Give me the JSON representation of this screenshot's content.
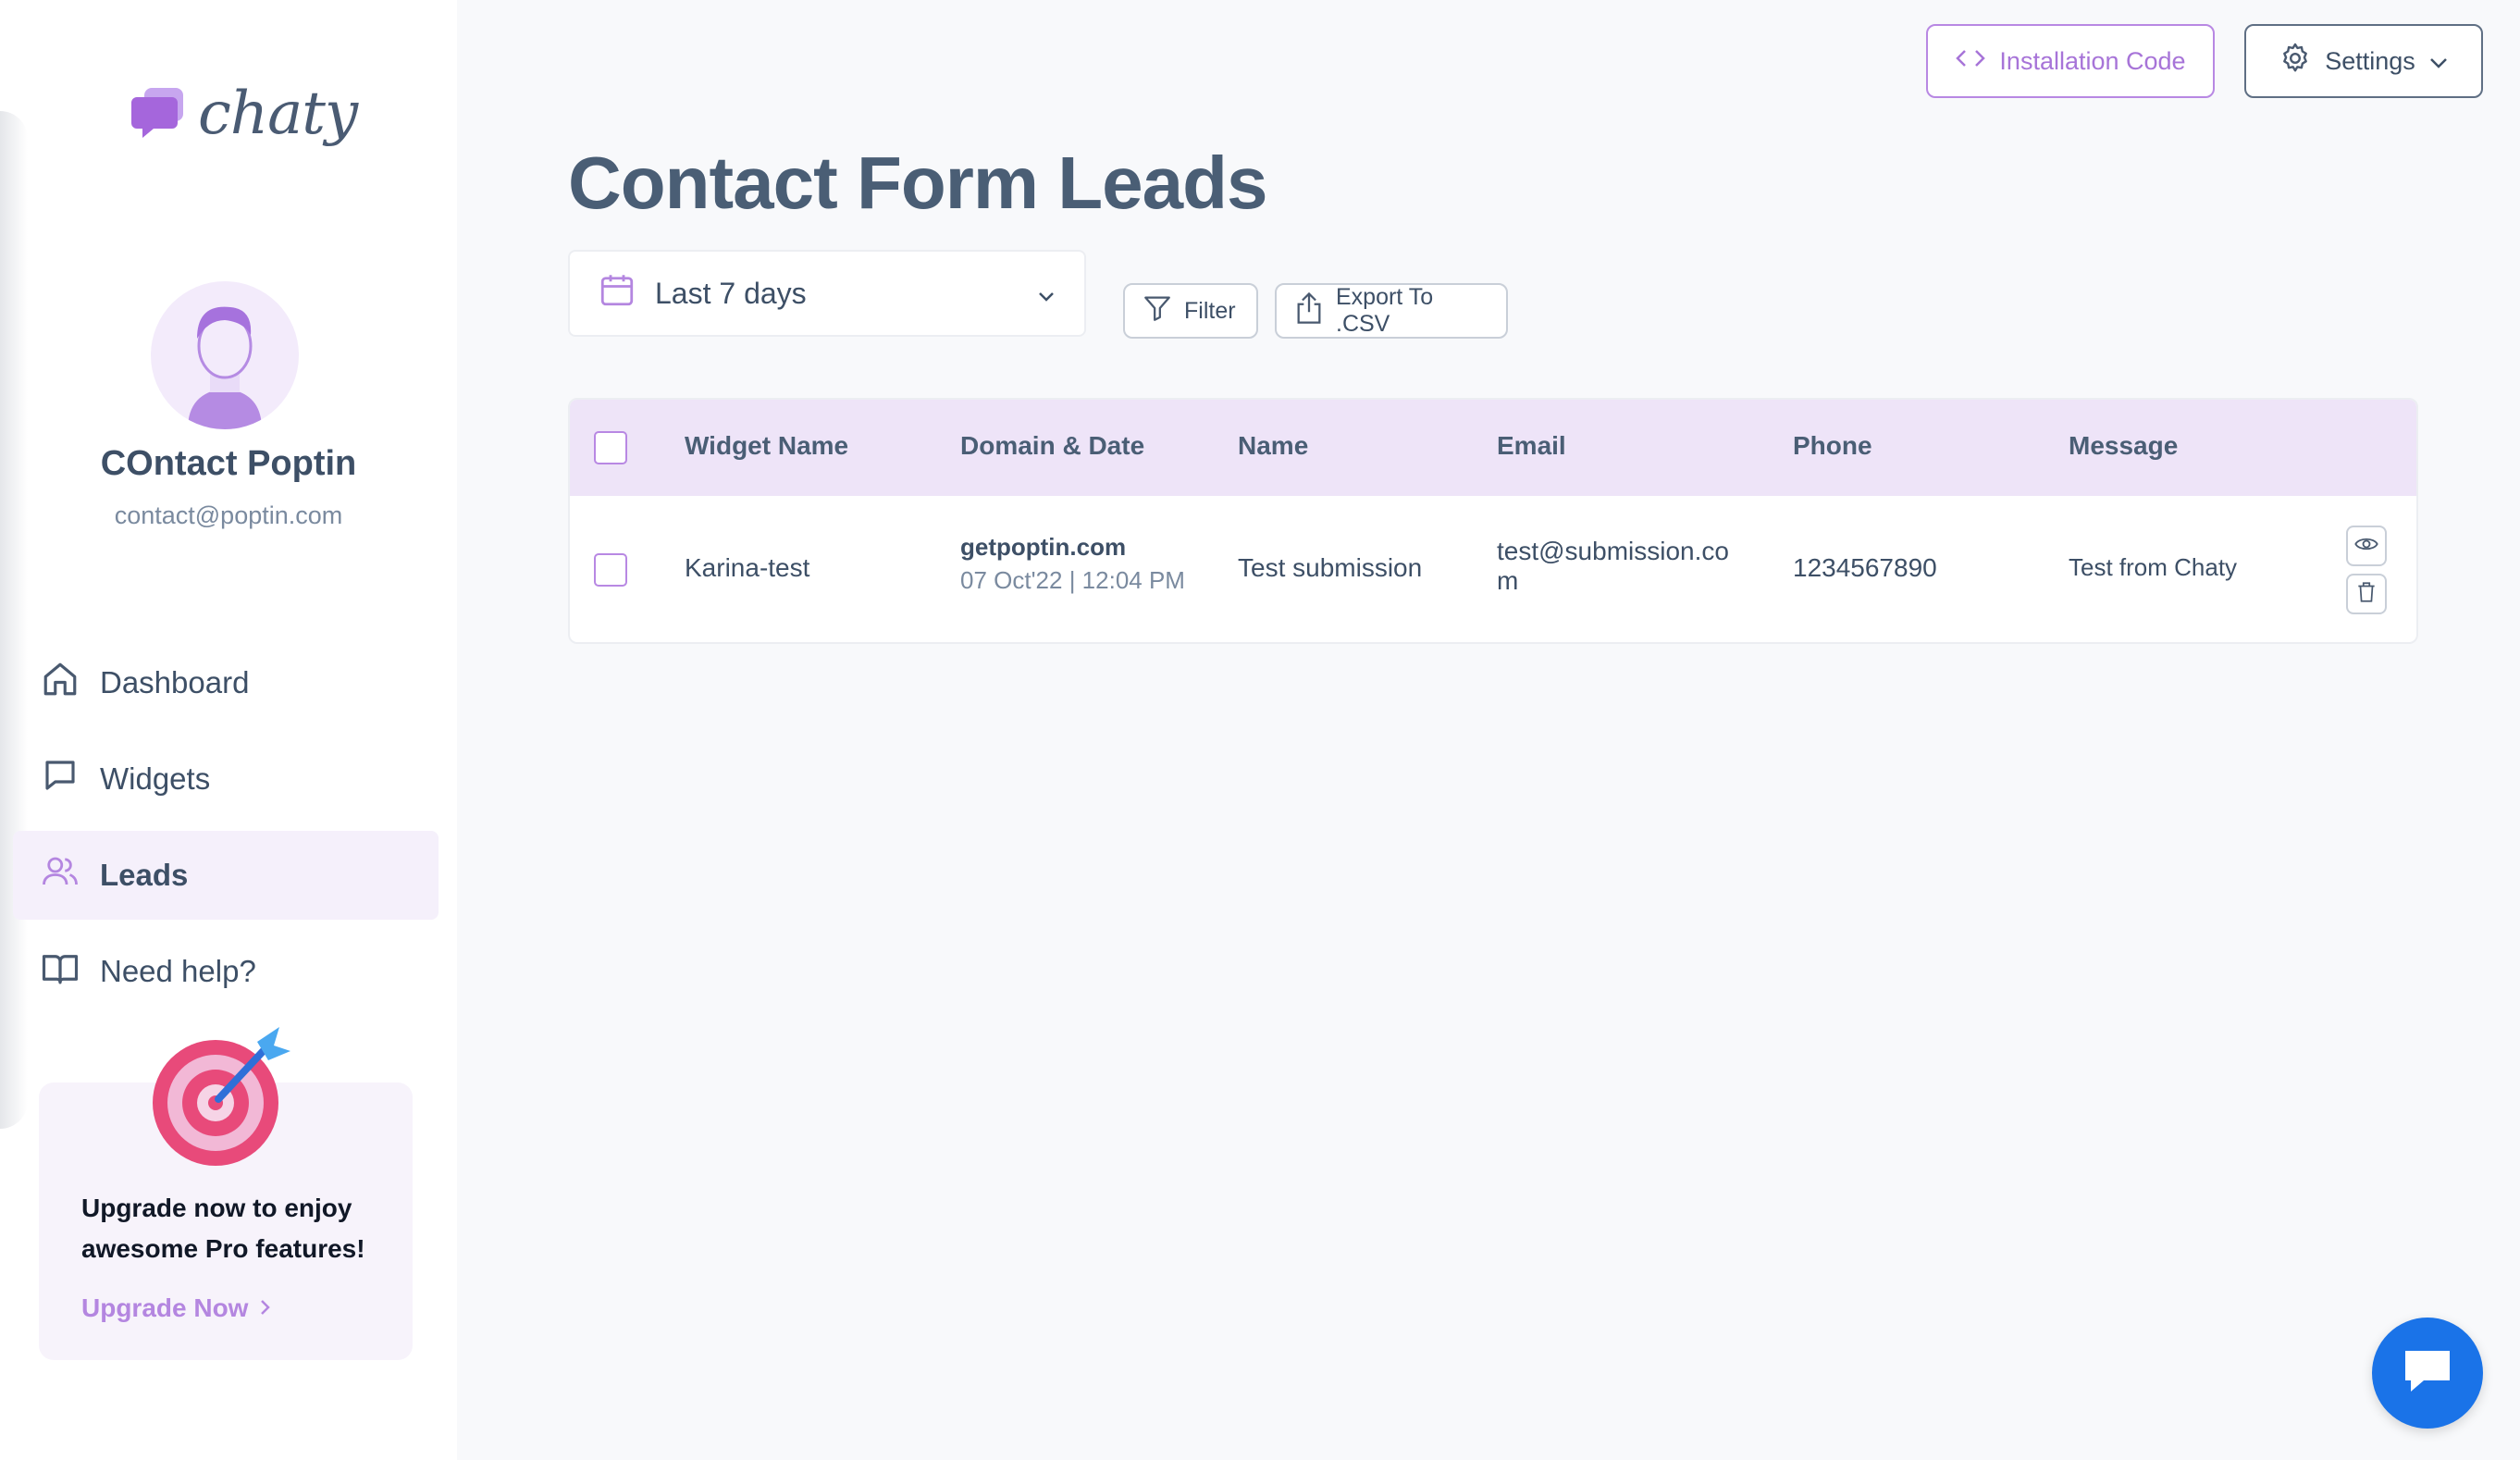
{
  "brand": {
    "logo_text": "chaty",
    "accent": "#b486e0"
  },
  "user": {
    "name": "COntact Poptin",
    "email": "contact@poptin.com"
  },
  "nav": {
    "items": [
      {
        "label": "Dashboard",
        "icon": "home-icon",
        "active": false
      },
      {
        "label": "Widgets",
        "icon": "chat-icon",
        "active": false
      },
      {
        "label": "Leads",
        "icon": "users-icon",
        "active": true
      },
      {
        "label": "Need help?",
        "icon": "book-icon",
        "active": false
      }
    ]
  },
  "upgrade": {
    "text": "Upgrade now to enjoy awesome Pro features!",
    "link_label": "Upgrade Now"
  },
  "header": {
    "install_label": "Installation Code",
    "settings_label": "Settings"
  },
  "page": {
    "title": "Contact Form Leads"
  },
  "toolbar": {
    "date_range": "Last 7 days",
    "filter_label": "Filter",
    "export_label": "Export To .CSV"
  },
  "table": {
    "columns": [
      "Widget Name",
      "Domain & Date",
      "Name",
      "Email",
      "Phone",
      "Message"
    ],
    "rows": [
      {
        "widget_name": "Karina-test",
        "domain": "getpoptin.com",
        "date": "07 Oct'22 | 12:04 PM",
        "name": "Test submission",
        "email_line1": "test@submission.co",
        "email_line2": "m",
        "phone": "1234567890",
        "message": "Test from Chaty"
      }
    ]
  }
}
